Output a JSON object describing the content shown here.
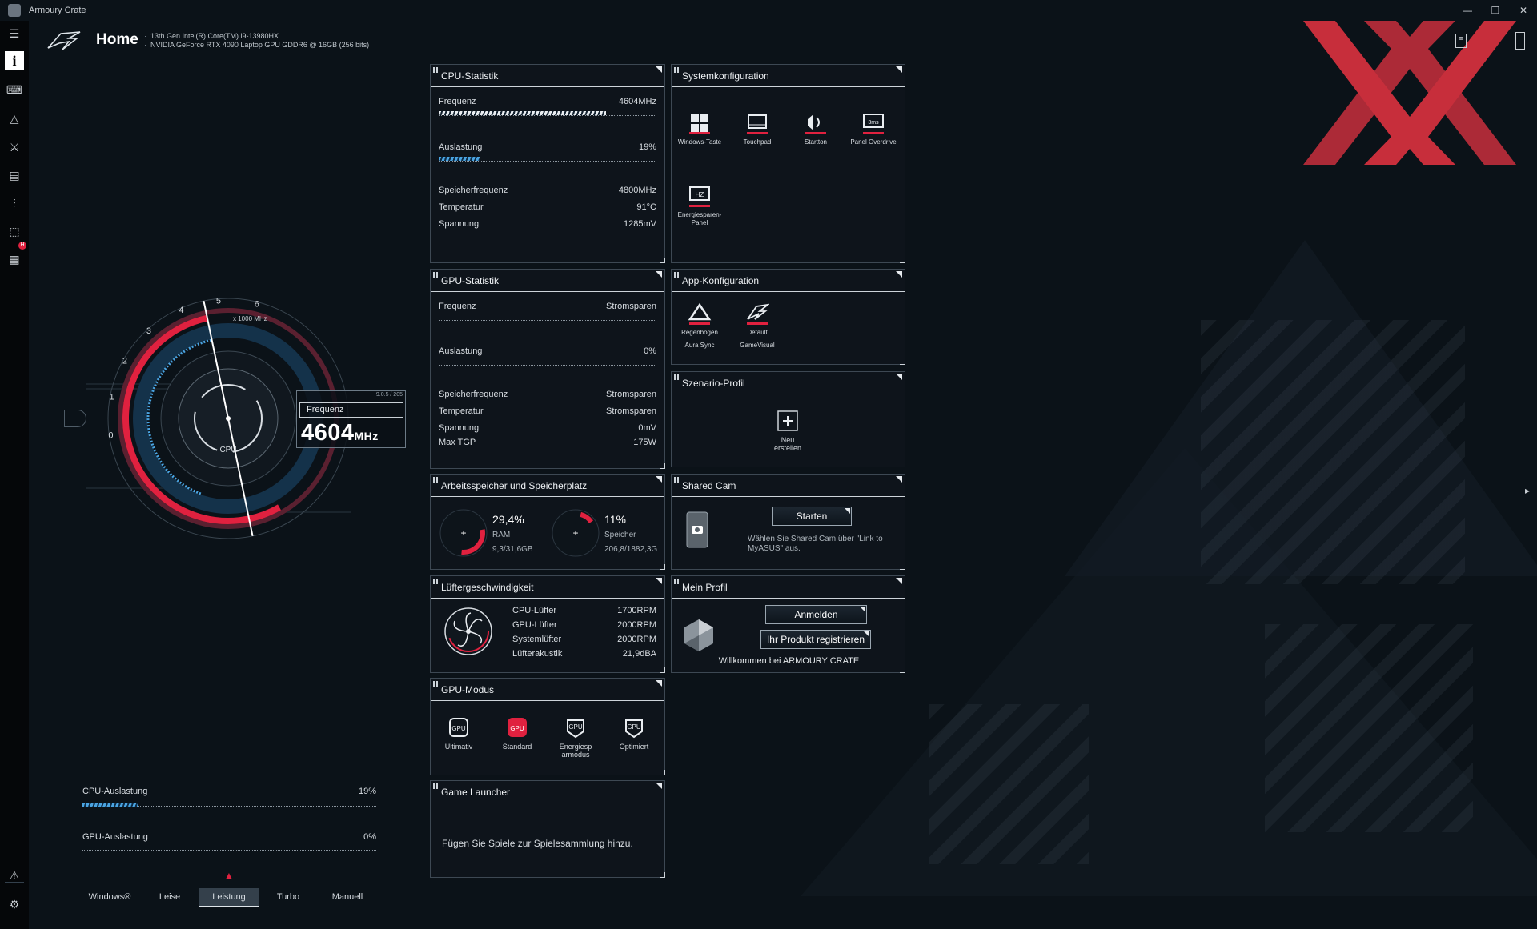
{
  "app": {
    "title": "Armoury Crate"
  },
  "header": {
    "title": "Home",
    "cpu_line": "13th Gen Intel(R) Core(TM) i9-13980HX",
    "gpu_line": "NVIDIA GeForce RTX 4090 Laptop GPU GDDR6 @ 16GB (256 bits)"
  },
  "gauge": {
    "unit_label": "x 1000 MHz",
    "ticks": [
      "0",
      "1",
      "2",
      "3",
      "4",
      "5",
      "6"
    ],
    "center_label": "CPU",
    "box_label": "Frequenz",
    "box_tiny": "9.0.5 / 205",
    "value": "4604",
    "unit": "MHz",
    "fraction": 0.77
  },
  "left_stats": {
    "cpu_label": "CPU-Auslastung",
    "cpu_value": "19%",
    "cpu_fraction": 0.19,
    "gpu_label": "GPU-Auslastung",
    "gpu_value": "0%",
    "gpu_fraction": 0
  },
  "modes": {
    "items": [
      "Windows®",
      "Leise",
      "Leistung",
      "Turbo",
      "Manuell"
    ],
    "active": "Leistung"
  },
  "cpu_stats": {
    "title": "CPU-Statistik",
    "freq_label": "Frequenz",
    "freq_value": "4604MHz",
    "freq_fraction": 0.77,
    "util_label": "Auslastung",
    "util_value": "19%",
    "util_fraction": 0.19,
    "mem_label": "Speicherfrequenz",
    "mem_value": "4800MHz",
    "temp_label": "Temperatur",
    "temp_value": "91°C",
    "volt_label": "Spannung",
    "volt_value": "1285mV"
  },
  "gpu_stats": {
    "title": "GPU-Statistik",
    "freq_label": "Frequenz",
    "freq_value": "Stromsparen",
    "util_label": "Auslastung",
    "util_value": "0%",
    "mem_label": "Speicherfrequenz",
    "mem_value": "Stromsparen",
    "temp_label": "Temperatur",
    "temp_value": "Stromsparen",
    "volt_label": "Spannung",
    "volt_value": "0mV",
    "tgp_label": "Max TGP",
    "tgp_value": "175W"
  },
  "memory": {
    "title": "Arbeitsspeicher und Speicherplatz",
    "ram_percent": "29,4%",
    "ram_label": "RAM",
    "ram_detail": "9,3/31,6GB",
    "ram_fraction": 0.294,
    "disk_percent": "11%",
    "disk_label": "Speicher",
    "disk_detail": "206,8/1882,3G",
    "disk_fraction": 0.11
  },
  "fans": {
    "title": "Lüftergeschwindigkeit",
    "rows": [
      {
        "label": "CPU-Lüfter",
        "value": "1700RPM"
      },
      {
        "label": "GPU-Lüfter",
        "value": "2000RPM"
      },
      {
        "label": "Systemlüfter",
        "value": "2000RPM"
      },
      {
        "label": "Lüfterakustik",
        "value": "21,9dBA"
      }
    ]
  },
  "gpu_mode": {
    "title": "GPU-Modus",
    "items": [
      {
        "label": "Ultimativ",
        "icon": "gpu-ultimate-icon"
      },
      {
        "label": "Standard",
        "icon": "gpu-standard-icon"
      },
      {
        "label": "Energiesp armodus",
        "icon": "gpu-eco-icon"
      },
      {
        "label": "Optimiert",
        "icon": "gpu-optimized-icon"
      }
    ],
    "active": "Standard"
  },
  "game_launcher": {
    "title": "Game Launcher",
    "text": "Fügen Sie Spiele zur Spielesammlung hinzu."
  },
  "sys_config": {
    "title": "Systemkonfiguration",
    "items": [
      "Windows-Taste",
      "Touchpad",
      "Startton",
      "Panel Overdrive",
      "Energiesparen-Panel"
    ]
  },
  "app_config": {
    "title": "App-Konfiguration",
    "items": [
      {
        "value": "Regenbogen",
        "label": "Aura Sync"
      },
      {
        "value": "Default",
        "label": "GameVisual"
      }
    ]
  },
  "scenario": {
    "title": "Szenario-Profil",
    "new_label": "Neu erstellen"
  },
  "shared_cam": {
    "title": "Shared Cam",
    "button": "Starten",
    "text": "Wählen Sie Shared Cam über \"Link to MyASUS\" aus."
  },
  "profile": {
    "title": "Mein Profil",
    "login_button": "Anmelden",
    "register_button": "Ihr Produkt registrieren",
    "welcome": "Willkommen bei ARMOURY CRATE"
  },
  "colors": {
    "accent_red": "#e0213f",
    "accent_blue": "#4aa3e0",
    "background": "#0b1218"
  },
  "rail": {
    "items": [
      "info-icon",
      "keyboard-icon",
      "aura-icon",
      "armoury-icon",
      "scenario-icon",
      "settings-sliders-icon",
      "deals-icon",
      "news-icon"
    ],
    "badge": "H"
  }
}
